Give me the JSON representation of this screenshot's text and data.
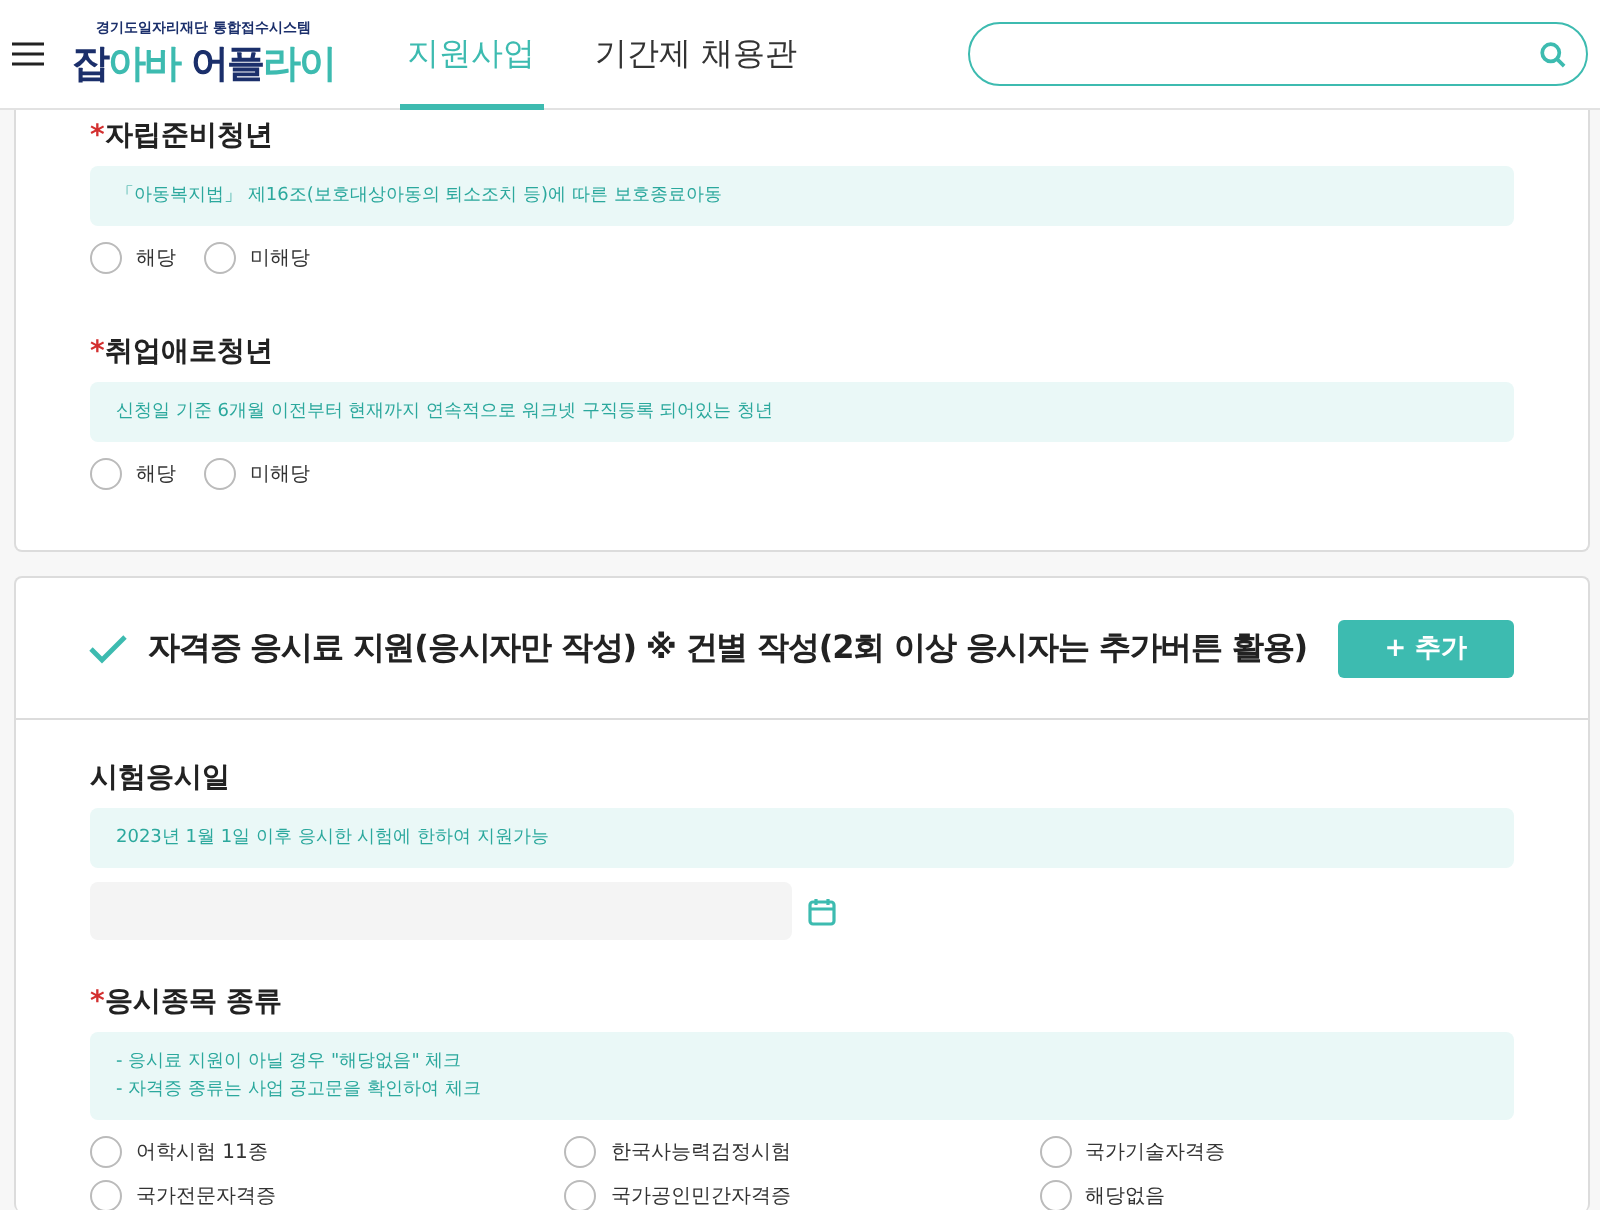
{
  "header": {
    "logo_caption": "경기도일자리재단 통합접수시스템",
    "logo_parts": [
      {
        "text": "잡",
        "color": "#1b2f6b"
      },
      {
        "text": "아바 ",
        "color": "#3dbbb0"
      },
      {
        "text": "어플",
        "color": "#1b2f6b"
      },
      {
        "text": "라이",
        "color": "#3dbbb0"
      }
    ],
    "nav": [
      {
        "label": "지원사업",
        "selected": true
      },
      {
        "label": "기간제 채용관",
        "selected": false
      }
    ],
    "search": {
      "kind": "pill"
    }
  },
  "eligibility_card": {
    "questions": [
      {
        "title": "자립준비청년",
        "required_mark": "*",
        "note": [
          "「아동복지법」 제16조(보호대상아동의 퇴소조치 등)에 따른 보호종료아동"
        ],
        "options": [
          {
            "label": "해당",
            "selected": false
          },
          {
            "label": "미해당",
            "selected": false
          }
        ]
      },
      {
        "title": "취업애로청년",
        "required_mark": "*",
        "note": [
          "신청일 기준 6개월 이전부터 현재까지 연속적으로 워크넷 구직등록 되어있는 청년"
        ],
        "options": [
          {
            "label": "해당",
            "selected": false
          },
          {
            "label": "미해당",
            "selected": false
          }
        ]
      }
    ]
  },
  "exam_card": {
    "title": "자격증 응시료 지원(응시자만 작성) ※ 건별 작성(2회 이상 응시자는 추가버튼 활용)",
    "add_button": "+ 추가",
    "date_field": {
      "title": "시험응시일",
      "note": [
        "2023년 1월 1일 이후 응시한 시험에 한하여 지원가능"
      ]
    },
    "type_field": {
      "title": "응시종목 종류",
      "required_mark": "*",
      "note": [
        "- 응시료 지원이 아닐 경우 \"해당없음\" 체크",
        "- 자격증 종류는 사업 공고문을 확인하여 체크"
      ],
      "options": [
        {
          "label": "어학시험 11종",
          "selected": false
        },
        {
          "label": "한국사능력검정시험",
          "selected": false
        },
        {
          "label": "국가기술자격증",
          "selected": false
        },
        {
          "label": "국가전문자격증",
          "selected": false
        },
        {
          "label": "국가공인민간자격증",
          "selected": false
        },
        {
          "label": "해당없음",
          "selected": false
        }
      ]
    }
  }
}
